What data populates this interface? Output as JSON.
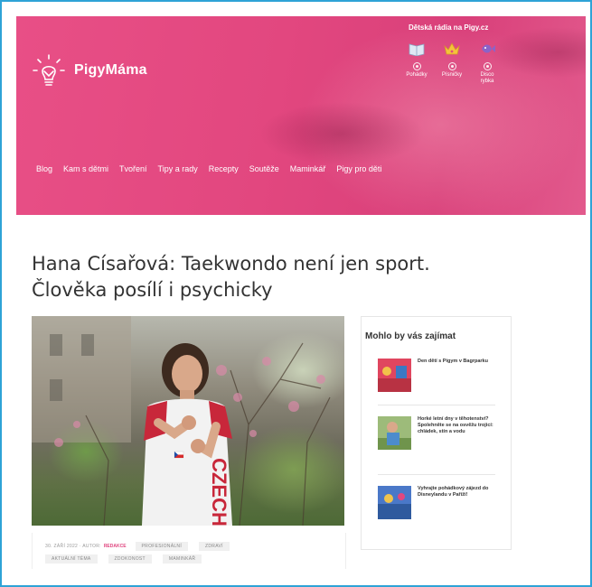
{
  "brand": {
    "name": "PigyMáma"
  },
  "radio": {
    "title": "Dětská rádia na Pigy.cz",
    "items": [
      {
        "label": "Pohádky",
        "icon": "book-icon"
      },
      {
        "label": "Písničky",
        "icon": "crown-icon"
      },
      {
        "label": "Discoryska",
        "label_line1": "Disco",
        "label_line2": "rybka",
        "icon": "fish-icon"
      }
    ]
  },
  "nav": {
    "items": [
      "Blog",
      "Kam s dětmi",
      "Tvoření",
      "Tipy a rady",
      "Recepty",
      "Soutěže",
      "Maminkář",
      "Pigy pro děti"
    ]
  },
  "article": {
    "title_line1": "Hana Císařová: Taekwondo není jen sport.",
    "title_line2": "Člověka posílí i psychicky",
    "meta_date": "30. ZÁŘÍ 2022 · AUTOR:",
    "meta_author": "REDAKCE",
    "tags": [
      "PROFESIONÁLNÍ",
      "ZDRAVÍ",
      "AKTUÁLNÍ TÉMA",
      "ZDOKONOST",
      "MAMINKÁŘ"
    ],
    "photo_shirt_text": "CZECH"
  },
  "sidebar": {
    "title": "Mohlo by vás zajímat",
    "items": [
      {
        "text": "Den dětí s Pigym v Bagrparku"
      },
      {
        "text": "Horké letní dny v těhotenství? Spolehněte se na osvěžu trojicí: chládek, stín a vodu"
      },
      {
        "text": "Vyhrajte pohádkový zájezd do Disneylandu v Paříži!"
      }
    ]
  },
  "colors": {
    "brand_pink": "#e2477f",
    "frame_blue": "#2ea3d6",
    "author_pink": "#e0457f"
  }
}
